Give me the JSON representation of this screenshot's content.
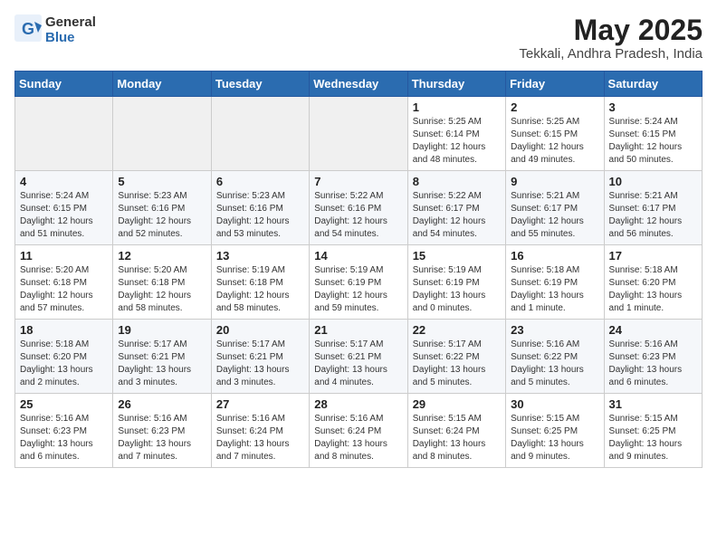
{
  "header": {
    "logo_line1": "General",
    "logo_line2": "Blue",
    "month_year": "May 2025",
    "location": "Tekkali, Andhra Pradesh, India"
  },
  "weekdays": [
    "Sunday",
    "Monday",
    "Tuesday",
    "Wednesday",
    "Thursday",
    "Friday",
    "Saturday"
  ],
  "weeks": [
    [
      {
        "day": "",
        "info": ""
      },
      {
        "day": "",
        "info": ""
      },
      {
        "day": "",
        "info": ""
      },
      {
        "day": "",
        "info": ""
      },
      {
        "day": "1",
        "info": "Sunrise: 5:25 AM\nSunset: 6:14 PM\nDaylight: 12 hours\nand 48 minutes."
      },
      {
        "day": "2",
        "info": "Sunrise: 5:25 AM\nSunset: 6:15 PM\nDaylight: 12 hours\nand 49 minutes."
      },
      {
        "day": "3",
        "info": "Sunrise: 5:24 AM\nSunset: 6:15 PM\nDaylight: 12 hours\nand 50 minutes."
      }
    ],
    [
      {
        "day": "4",
        "info": "Sunrise: 5:24 AM\nSunset: 6:15 PM\nDaylight: 12 hours\nand 51 minutes."
      },
      {
        "day": "5",
        "info": "Sunrise: 5:23 AM\nSunset: 6:16 PM\nDaylight: 12 hours\nand 52 minutes."
      },
      {
        "day": "6",
        "info": "Sunrise: 5:23 AM\nSunset: 6:16 PM\nDaylight: 12 hours\nand 53 minutes."
      },
      {
        "day": "7",
        "info": "Sunrise: 5:22 AM\nSunset: 6:16 PM\nDaylight: 12 hours\nand 54 minutes."
      },
      {
        "day": "8",
        "info": "Sunrise: 5:22 AM\nSunset: 6:17 PM\nDaylight: 12 hours\nand 54 minutes."
      },
      {
        "day": "9",
        "info": "Sunrise: 5:21 AM\nSunset: 6:17 PM\nDaylight: 12 hours\nand 55 minutes."
      },
      {
        "day": "10",
        "info": "Sunrise: 5:21 AM\nSunset: 6:17 PM\nDaylight: 12 hours\nand 56 minutes."
      }
    ],
    [
      {
        "day": "11",
        "info": "Sunrise: 5:20 AM\nSunset: 6:18 PM\nDaylight: 12 hours\nand 57 minutes."
      },
      {
        "day": "12",
        "info": "Sunrise: 5:20 AM\nSunset: 6:18 PM\nDaylight: 12 hours\nand 58 minutes."
      },
      {
        "day": "13",
        "info": "Sunrise: 5:19 AM\nSunset: 6:18 PM\nDaylight: 12 hours\nand 58 minutes."
      },
      {
        "day": "14",
        "info": "Sunrise: 5:19 AM\nSunset: 6:19 PM\nDaylight: 12 hours\nand 59 minutes."
      },
      {
        "day": "15",
        "info": "Sunrise: 5:19 AM\nSunset: 6:19 PM\nDaylight: 13 hours\nand 0 minutes."
      },
      {
        "day": "16",
        "info": "Sunrise: 5:18 AM\nSunset: 6:19 PM\nDaylight: 13 hours\nand 1 minute."
      },
      {
        "day": "17",
        "info": "Sunrise: 5:18 AM\nSunset: 6:20 PM\nDaylight: 13 hours\nand 1 minute."
      }
    ],
    [
      {
        "day": "18",
        "info": "Sunrise: 5:18 AM\nSunset: 6:20 PM\nDaylight: 13 hours\nand 2 minutes."
      },
      {
        "day": "19",
        "info": "Sunrise: 5:17 AM\nSunset: 6:21 PM\nDaylight: 13 hours\nand 3 minutes."
      },
      {
        "day": "20",
        "info": "Sunrise: 5:17 AM\nSunset: 6:21 PM\nDaylight: 13 hours\nand 3 minutes."
      },
      {
        "day": "21",
        "info": "Sunrise: 5:17 AM\nSunset: 6:21 PM\nDaylight: 13 hours\nand 4 minutes."
      },
      {
        "day": "22",
        "info": "Sunrise: 5:17 AM\nSunset: 6:22 PM\nDaylight: 13 hours\nand 5 minutes."
      },
      {
        "day": "23",
        "info": "Sunrise: 5:16 AM\nSunset: 6:22 PM\nDaylight: 13 hours\nand 5 minutes."
      },
      {
        "day": "24",
        "info": "Sunrise: 5:16 AM\nSunset: 6:23 PM\nDaylight: 13 hours\nand 6 minutes."
      }
    ],
    [
      {
        "day": "25",
        "info": "Sunrise: 5:16 AM\nSunset: 6:23 PM\nDaylight: 13 hours\nand 6 minutes."
      },
      {
        "day": "26",
        "info": "Sunrise: 5:16 AM\nSunset: 6:23 PM\nDaylight: 13 hours\nand 7 minutes."
      },
      {
        "day": "27",
        "info": "Sunrise: 5:16 AM\nSunset: 6:24 PM\nDaylight: 13 hours\nand 7 minutes."
      },
      {
        "day": "28",
        "info": "Sunrise: 5:16 AM\nSunset: 6:24 PM\nDaylight: 13 hours\nand 8 minutes."
      },
      {
        "day": "29",
        "info": "Sunrise: 5:15 AM\nSunset: 6:24 PM\nDaylight: 13 hours\nand 8 minutes."
      },
      {
        "day": "30",
        "info": "Sunrise: 5:15 AM\nSunset: 6:25 PM\nDaylight: 13 hours\nand 9 minutes."
      },
      {
        "day": "31",
        "info": "Sunrise: 5:15 AM\nSunset: 6:25 PM\nDaylight: 13 hours\nand 9 minutes."
      }
    ]
  ]
}
